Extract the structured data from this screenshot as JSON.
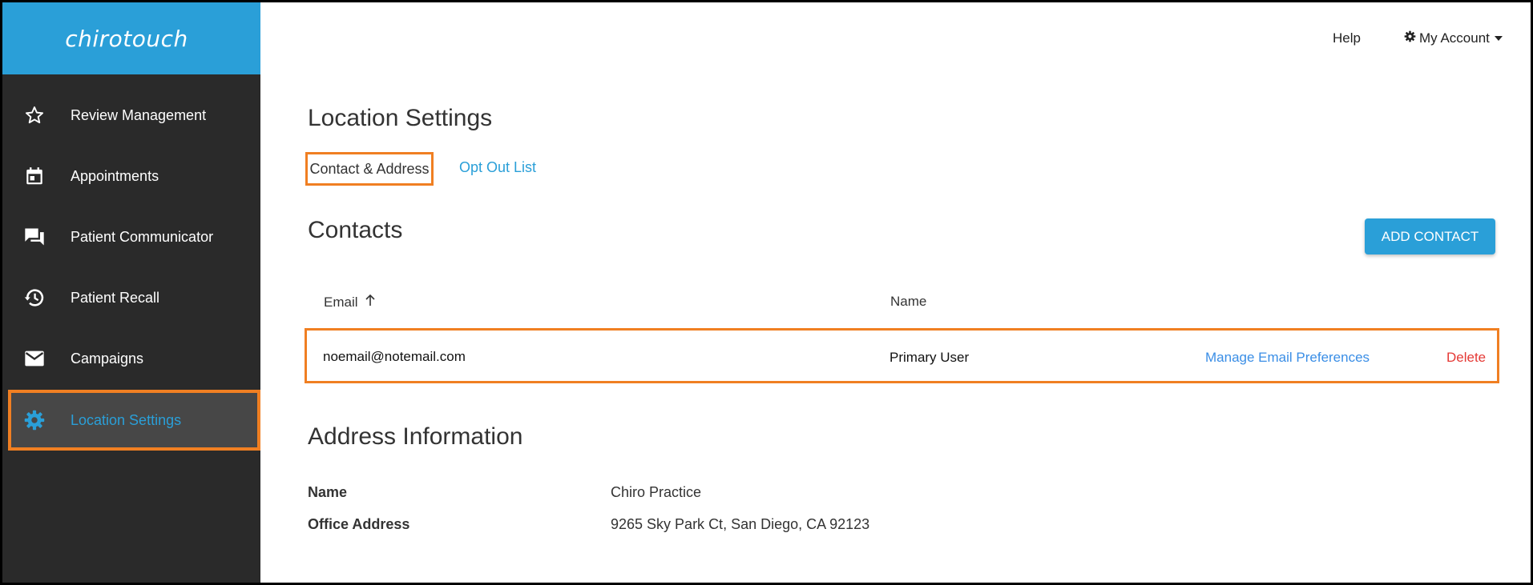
{
  "brand": {
    "logo_text": "chirotouch",
    "color": "#2a9fd8"
  },
  "sidebar": {
    "items": [
      {
        "label": "Review Management",
        "icon": "star-outline-icon"
      },
      {
        "label": "Appointments",
        "icon": "calendar-icon"
      },
      {
        "label": "Patient Communicator",
        "icon": "chat-bubbles-icon"
      },
      {
        "label": "Patient Recall",
        "icon": "history-icon"
      },
      {
        "label": "Campaigns",
        "icon": "envelope-icon"
      },
      {
        "label": "Location Settings",
        "icon": "gear-icon",
        "active": true
      }
    ]
  },
  "topbar": {
    "help_label": "Help",
    "account_label": "My Account",
    "account_icon": "gear-icon"
  },
  "page": {
    "title": "Location Settings",
    "tabs": [
      {
        "label": "Contact & Address",
        "active": true
      },
      {
        "label": "Opt Out List",
        "active": false
      }
    ]
  },
  "contacts": {
    "heading": "Contacts",
    "add_button_label": "ADD CONTACT",
    "columns": {
      "email": "Email",
      "name": "Name",
      "email_sort": "ascending"
    },
    "rows": [
      {
        "email": "noemail@notemail.com",
        "name": "Primary User",
        "manage_label": "Manage Email Preferences",
        "delete_label": "Delete"
      }
    ]
  },
  "address": {
    "heading": "Address Information",
    "fields": [
      {
        "label": "Name",
        "value": "Chiro Practice"
      },
      {
        "label": "Office Address",
        "value": "9265 Sky Park Ct, San Diego, CA 92123"
      }
    ]
  },
  "colors": {
    "accent": "#2a9fd8",
    "highlight": "#f07f22",
    "sidebar_bg": "#2a2a2a",
    "danger": "#e53935",
    "link": "#3a8ee6"
  }
}
